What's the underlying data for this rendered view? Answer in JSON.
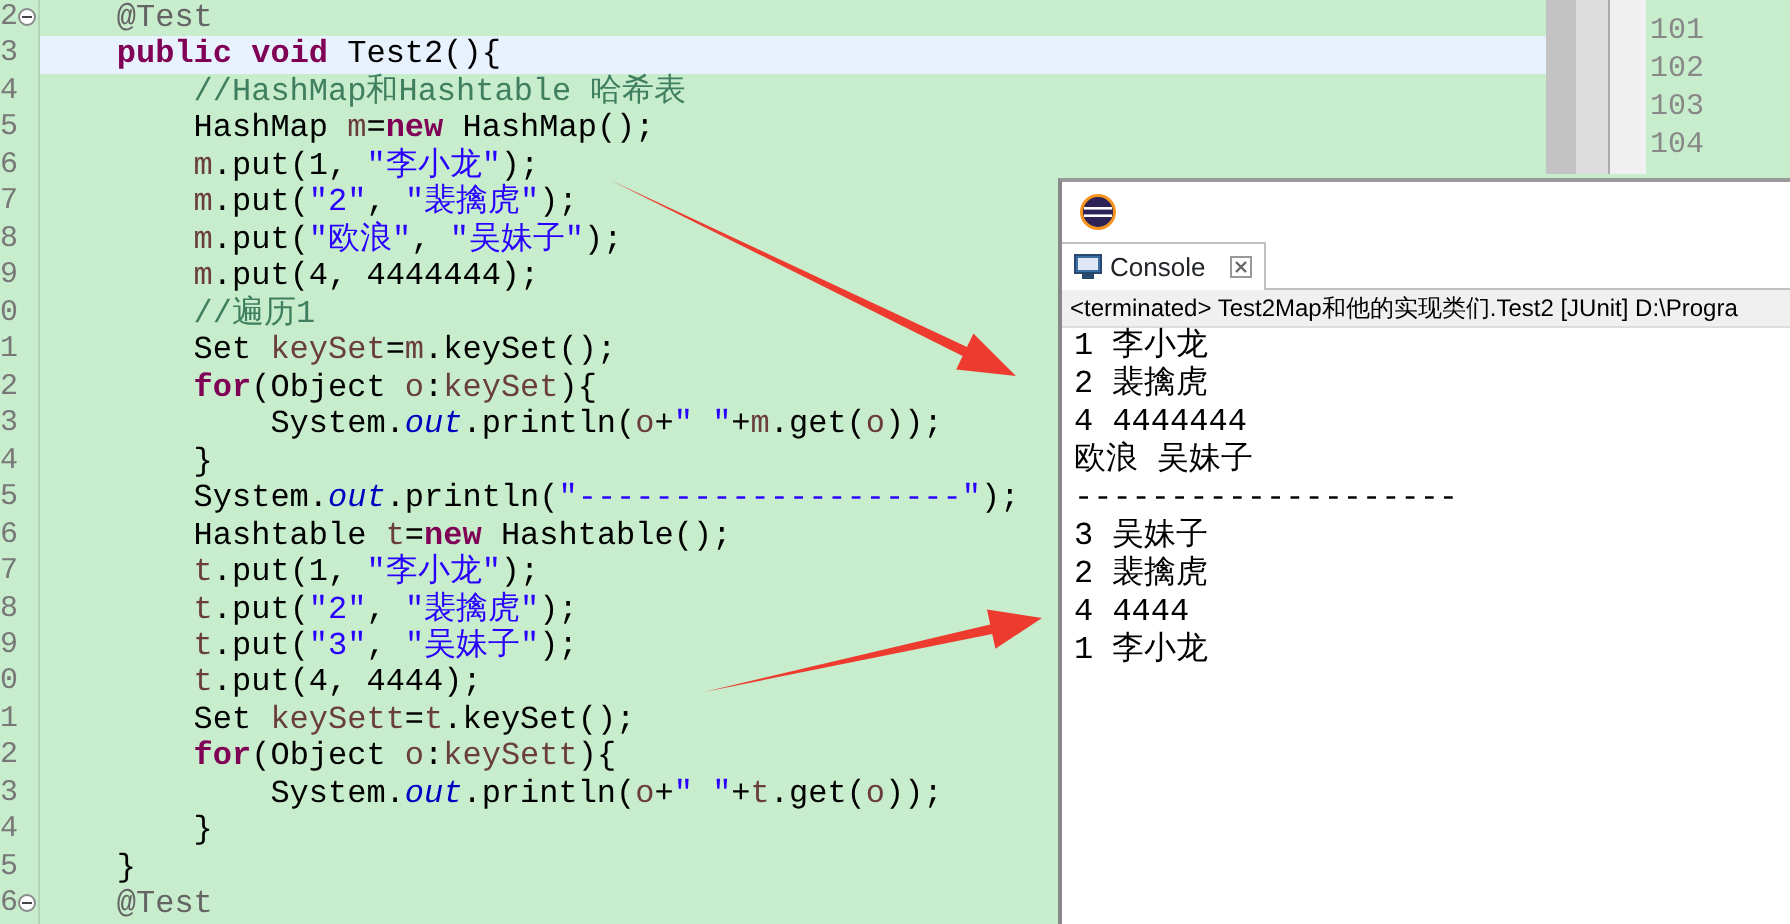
{
  "editor": {
    "lines": [
      {
        "number": "2",
        "foldable": true,
        "current": false,
        "tokens": [
          {
            "kind": "annotation",
            "text": "@Test"
          }
        ]
      },
      {
        "number": "3",
        "foldable": false,
        "current": true,
        "tokens": [
          {
            "kind": "keyword",
            "text": "public "
          },
          {
            "kind": "keyword",
            "text": "void"
          },
          {
            "kind": "plain",
            "text": " Test2(){"
          }
        ],
        "children": [
          {
            "number": "4",
            "foldable": false,
            "current": false,
            "tokens": [
              {
                "kind": "comment",
                "text": "//HashMap和Hashtable 哈希表"
              }
            ]
          },
          {
            "number": "5",
            "foldable": false,
            "current": false,
            "tokens": [
              {
                "kind": "plain",
                "text": "HashMap "
              },
              {
                "kind": "variable",
                "text": "m"
              },
              {
                "kind": "plain",
                "text": "="
              },
              {
                "kind": "keyword",
                "text": "new"
              },
              {
                "kind": "plain",
                "text": " HashMap();"
              }
            ]
          },
          {
            "number": "6",
            "foldable": false,
            "current": false,
            "tokens": [
              {
                "kind": "variable",
                "text": "m"
              },
              {
                "kind": "plain",
                "text": ".put(1, "
              },
              {
                "kind": "string",
                "text": "\"李小龙\""
              },
              {
                "kind": "plain",
                "text": ");"
              }
            ]
          },
          {
            "number": "7",
            "foldable": false,
            "current": false,
            "tokens": [
              {
                "kind": "variable",
                "text": "m"
              },
              {
                "kind": "plain",
                "text": ".put("
              },
              {
                "kind": "string",
                "text": "\"2\""
              },
              {
                "kind": "plain",
                "text": ", "
              },
              {
                "kind": "string",
                "text": "\"裴擒虎\""
              },
              {
                "kind": "plain",
                "text": ");"
              }
            ]
          },
          {
            "number": "8",
            "foldable": false,
            "current": false,
            "tokens": [
              {
                "kind": "variable",
                "text": "m"
              },
              {
                "kind": "plain",
                "text": ".put("
              },
              {
                "kind": "string",
                "text": "\"欧浪\""
              },
              {
                "kind": "plain",
                "text": ", "
              },
              {
                "kind": "string",
                "text": "\"吴妹子\""
              },
              {
                "kind": "plain",
                "text": ");"
              }
            ]
          },
          {
            "number": "9",
            "foldable": false,
            "current": false,
            "tokens": [
              {
                "kind": "variable",
                "text": "m"
              },
              {
                "kind": "plain",
                "text": ".put(4, 4444444);"
              }
            ]
          },
          {
            "number": "0",
            "foldable": false,
            "current": false,
            "tokens": [
              {
                "kind": "comment",
                "text": "//遍历1"
              }
            ]
          },
          {
            "number": "1",
            "foldable": false,
            "current": false,
            "tokens": [
              {
                "kind": "plain",
                "text": "Set "
              },
              {
                "kind": "variable",
                "text": "keySet"
              },
              {
                "kind": "plain",
                "text": "="
              },
              {
                "kind": "variable",
                "text": "m"
              },
              {
                "kind": "plain",
                "text": ".keySet();"
              }
            ]
          },
          {
            "number": "2",
            "foldable": false,
            "current": false,
            "tokens": [
              {
                "kind": "keyword",
                "text": "for"
              },
              {
                "kind": "plain",
                "text": "(Object "
              },
              {
                "kind": "variable",
                "text": "o"
              },
              {
                "kind": "plain",
                "text": ":"
              },
              {
                "kind": "variable",
                "text": "keySet"
              },
              {
                "kind": "plain",
                "text": "){"
              }
            ],
            "children": [
              {
                "number": "3",
                "foldable": false,
                "current": false,
                "tokens": [
                  {
                    "kind": "plain",
                    "text": "System."
                  },
                  {
                    "kind": "field",
                    "text": "out"
                  },
                  {
                    "kind": "plain",
                    "text": ".println("
                  },
                  {
                    "kind": "variable",
                    "text": "o"
                  },
                  {
                    "kind": "plain",
                    "text": "+"
                  },
                  {
                    "kind": "string",
                    "text": "\" \""
                  },
                  {
                    "kind": "plain",
                    "text": "+"
                  },
                  {
                    "kind": "variable",
                    "text": "m"
                  },
                  {
                    "kind": "plain",
                    "text": ".get("
                  },
                  {
                    "kind": "variable",
                    "text": "o"
                  },
                  {
                    "kind": "plain",
                    "text": "));"
                  }
                ]
              }
            ]
          },
          {
            "number": "4",
            "foldable": false,
            "current": false,
            "tokens": [
              {
                "kind": "plain",
                "text": "}"
              }
            ]
          },
          {
            "number": "5",
            "foldable": false,
            "current": false,
            "tokens": [
              {
                "kind": "plain",
                "text": "System."
              },
              {
                "kind": "field",
                "text": "out"
              },
              {
                "kind": "plain",
                "text": ".println("
              },
              {
                "kind": "string",
                "text": "\"--------------------\""
              },
              {
                "kind": "plain",
                "text": ");"
              }
            ]
          },
          {
            "number": "6",
            "foldable": false,
            "current": false,
            "tokens": [
              {
                "kind": "plain",
                "text": "Hashtable "
              },
              {
                "kind": "variable",
                "text": "t"
              },
              {
                "kind": "plain",
                "text": "="
              },
              {
                "kind": "keyword",
                "text": "new"
              },
              {
                "kind": "plain",
                "text": " Hashtable();"
              }
            ]
          },
          {
            "number": "7",
            "foldable": false,
            "current": false,
            "tokens": [
              {
                "kind": "variable",
                "text": "t"
              },
              {
                "kind": "plain",
                "text": ".put(1, "
              },
              {
                "kind": "string",
                "text": "\"李小龙\""
              },
              {
                "kind": "plain",
                "text": ");"
              }
            ]
          },
          {
            "number": "8",
            "foldable": false,
            "current": false,
            "tokens": [
              {
                "kind": "variable",
                "text": "t"
              },
              {
                "kind": "plain",
                "text": ".put("
              },
              {
                "kind": "string",
                "text": "\"2\""
              },
              {
                "kind": "plain",
                "text": ", "
              },
              {
                "kind": "string",
                "text": "\"裴擒虎\""
              },
              {
                "kind": "plain",
                "text": ");"
              }
            ]
          },
          {
            "number": "9",
            "foldable": false,
            "current": false,
            "tokens": [
              {
                "kind": "variable",
                "text": "t"
              },
              {
                "kind": "plain",
                "text": ".put("
              },
              {
                "kind": "string",
                "text": "\"3\""
              },
              {
                "kind": "plain",
                "text": ", "
              },
              {
                "kind": "string",
                "text": "\"吴妹子\""
              },
              {
                "kind": "plain",
                "text": ");"
              }
            ]
          },
          {
            "number": "0",
            "foldable": false,
            "current": false,
            "tokens": [
              {
                "kind": "variable",
                "text": "t"
              },
              {
                "kind": "plain",
                "text": ".put(4, 4444);"
              }
            ]
          },
          {
            "number": "1",
            "foldable": false,
            "current": false,
            "tokens": [
              {
                "kind": "plain",
                "text": "Set "
              },
              {
                "kind": "variable",
                "text": "keySett"
              },
              {
                "kind": "plain",
                "text": "="
              },
              {
                "kind": "variable",
                "text": "t"
              },
              {
                "kind": "plain",
                "text": ".keySet();"
              }
            ]
          },
          {
            "number": "2",
            "foldable": false,
            "current": false,
            "tokens": [
              {
                "kind": "keyword",
                "text": "for"
              },
              {
                "kind": "plain",
                "text": "(Object "
              },
              {
                "kind": "variable",
                "text": "o"
              },
              {
                "kind": "plain",
                "text": ":"
              },
              {
                "kind": "variable",
                "text": "keySett"
              },
              {
                "kind": "plain",
                "text": "){"
              }
            ],
            "children": [
              {
                "number": "3",
                "foldable": false,
                "current": false,
                "tokens": [
                  {
                    "kind": "plain",
                    "text": "System."
                  },
                  {
                    "kind": "field",
                    "text": "out"
                  },
                  {
                    "kind": "plain",
                    "text": ".println("
                  },
                  {
                    "kind": "variable",
                    "text": "o"
                  },
                  {
                    "kind": "plain",
                    "text": "+"
                  },
                  {
                    "kind": "string",
                    "text": "\" \""
                  },
                  {
                    "kind": "plain",
                    "text": "+"
                  },
                  {
                    "kind": "variable",
                    "text": "t"
                  },
                  {
                    "kind": "plain",
                    "text": ".get("
                  },
                  {
                    "kind": "variable",
                    "text": "o"
                  },
                  {
                    "kind": "plain",
                    "text": "));"
                  }
                ]
              }
            ]
          },
          {
            "number": "4",
            "foldable": false,
            "current": false,
            "tokens": [
              {
                "kind": "plain",
                "text": "}"
              }
            ]
          }
        ]
      },
      {
        "number": "5",
        "foldable": false,
        "current": false,
        "tokens": [
          {
            "kind": "plain",
            "text": "}"
          }
        ]
      },
      {
        "number": "6",
        "foldable": true,
        "current": false,
        "tokens": [
          {
            "kind": "annotation",
            "text": "@Test"
          }
        ]
      }
    ]
  },
  "side_editor": {
    "line_numbers": [
      "101",
      "102",
      "103",
      "104"
    ]
  },
  "console": {
    "tabs": [
      {
        "label": "Console",
        "selected": true
      }
    ],
    "status": "<terminated> Test2Map和他的实现类们.Test2 [JUnit] D:\\Progra",
    "output": [
      "1 李小龙",
      "2 裴擒虎",
      "4 4444444",
      "欧浪 吴妹子",
      "--------------------",
      "3 吴妹子",
      "2 裴擒虎",
      "4 4444",
      "1 李小龙"
    ]
  }
}
